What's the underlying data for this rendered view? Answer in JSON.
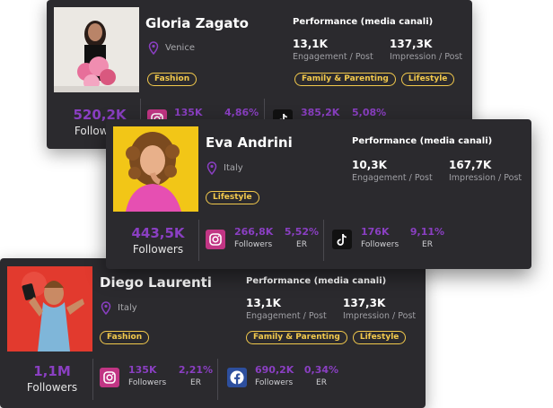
{
  "colors": {
    "accent": "#8a3fc2",
    "tag": "#f2c94c",
    "card_bg": "#2b2a2e"
  },
  "cards": [
    {
      "name": "Gloria Zagato",
      "location": "Venice",
      "tags": [
        "Fashion"
      ],
      "perf_tags": [
        "Family & Parenting",
        "Lifestyle"
      ],
      "perf_title": "Performance (media canali)",
      "engagement": {
        "value": "13,1K",
        "label": "Engagement / Post"
      },
      "impression": {
        "value": "137,3K",
        "label": "Impression / Post"
      },
      "followers_total": {
        "value": "520,2K",
        "label": "Followers"
      },
      "social": [
        {
          "icon": "instagram-icon",
          "followers": "135K",
          "er": "4,86%"
        },
        {
          "icon": "tiktok-icon",
          "followers": "385,2K",
          "er": "5,08%"
        }
      ]
    },
    {
      "name": "Eva Andrini",
      "location": "Italy",
      "tags": [
        "Lifestyle"
      ],
      "perf_title": "Performance (media canali)",
      "engagement": {
        "value": "10,3K",
        "label": "Engagement / Post"
      },
      "impression": {
        "value": "167,7K",
        "label": "Impression / Post"
      },
      "followers_total": {
        "value": "443,5K",
        "label": "Followers"
      },
      "social": [
        {
          "icon": "instagram-icon",
          "followers": "266,8K",
          "followers_label": "Followers",
          "er": "5,52%",
          "er_label": "ER"
        },
        {
          "icon": "tiktok-icon",
          "followers": "176K",
          "followers_label": "Followers",
          "er": "9,11%",
          "er_label": "ER"
        }
      ]
    },
    {
      "name": "Diego Laurenti",
      "location": "Italy",
      "tags": [
        "Fashion"
      ],
      "perf_tags": [
        "Family & Parenting",
        "Lifestyle"
      ],
      "perf_title": "Performance (media canali)",
      "engagement": {
        "value": "13,1K",
        "label": "Engagement / Post"
      },
      "impression": {
        "value": "137,3K",
        "label": "Impression / Post"
      },
      "followers_total": {
        "value": "1,1M",
        "label": "Followers"
      },
      "social": [
        {
          "icon": "instagram-icon",
          "followers": "135K",
          "followers_label": "Followers",
          "er": "2,21%",
          "er_label": "ER"
        },
        {
          "icon": "facebook-icon",
          "followers": "690,2K",
          "followers_label": "Followers",
          "er": "0,34%",
          "er_label": "ER"
        }
      ]
    }
  ]
}
